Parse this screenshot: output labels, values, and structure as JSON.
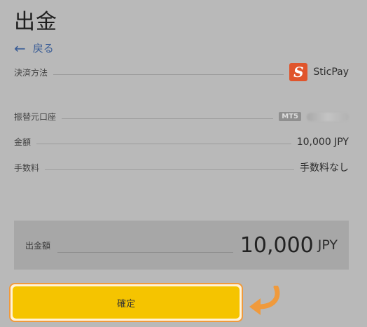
{
  "page": {
    "title": "出金",
    "back_label": "戻る",
    "back_icon": "←"
  },
  "details": [
    {
      "label": "決済方法",
      "value": "SticPay",
      "logo_letter": "S"
    },
    {
      "label": "振替元口座",
      "badge": "MT5",
      "value": ""
    },
    {
      "label": "金額",
      "value": "10,000 JPY"
    },
    {
      "label": "手数料",
      "value": "手数料なし"
    }
  ],
  "total": {
    "label": "出金額",
    "amount": "10,000",
    "currency": "JPY"
  },
  "confirm": {
    "label": "確定"
  },
  "colors": {
    "overlay_bg": "#b9b9b9",
    "link": "#3d5f97",
    "button": "#f5c400",
    "highlight": "#f09a3c",
    "sticpay": "#e0552c"
  }
}
